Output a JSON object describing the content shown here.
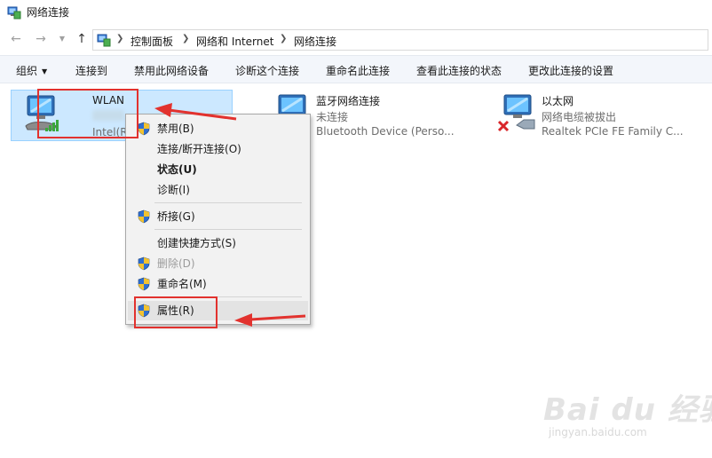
{
  "window": {
    "title": "网络连接"
  },
  "address": {
    "crumbs": [
      "控制面板",
      "网络和 Internet",
      "网络连接"
    ]
  },
  "toolbar": {
    "organize": "组织",
    "connect_to": "连接到",
    "disable_device": "禁用此网络设备",
    "diagnose": "诊断这个连接",
    "rename": "重命名此连接",
    "view_status": "查看此连接的状态",
    "change_settings": "更改此连接的设置"
  },
  "connections": [
    {
      "name": "WLAN",
      "status": "",
      "device": "Intel(R)",
      "selected": true
    },
    {
      "name": "蓝牙网络连接",
      "status": "未连接",
      "device": "Bluetooth Device (Perso...",
      "selected": false
    },
    {
      "name": "以太网",
      "status": "网络电缆被拔出",
      "device": "Realtek PCIe FE Family C...",
      "selected": false
    }
  ],
  "context_menu": {
    "items": [
      {
        "label": "禁用(B)",
        "shield": true
      },
      {
        "label": "连接/断开连接(O)",
        "shield": false
      },
      {
        "label": "状态(U)",
        "shield": false,
        "bold": true
      },
      {
        "label": "诊断(I)",
        "shield": false
      },
      {
        "label": "桥接(G)",
        "shield": true
      },
      {
        "label": "创建快捷方式(S)",
        "shield": false
      },
      {
        "label": "删除(D)",
        "shield": true,
        "disabled": true
      },
      {
        "label": "重命名(M)",
        "shield": true
      },
      {
        "label": "属性(R)",
        "shield": true,
        "highlighted": true
      }
    ]
  },
  "watermark": {
    "logo": "Bai du 经验",
    "url": "jingyan.baidu.com"
  },
  "colors": {
    "selection": "#cce8ff",
    "annotation_red": "#e2322e",
    "toolbar_bg": "#f3f6fb"
  }
}
